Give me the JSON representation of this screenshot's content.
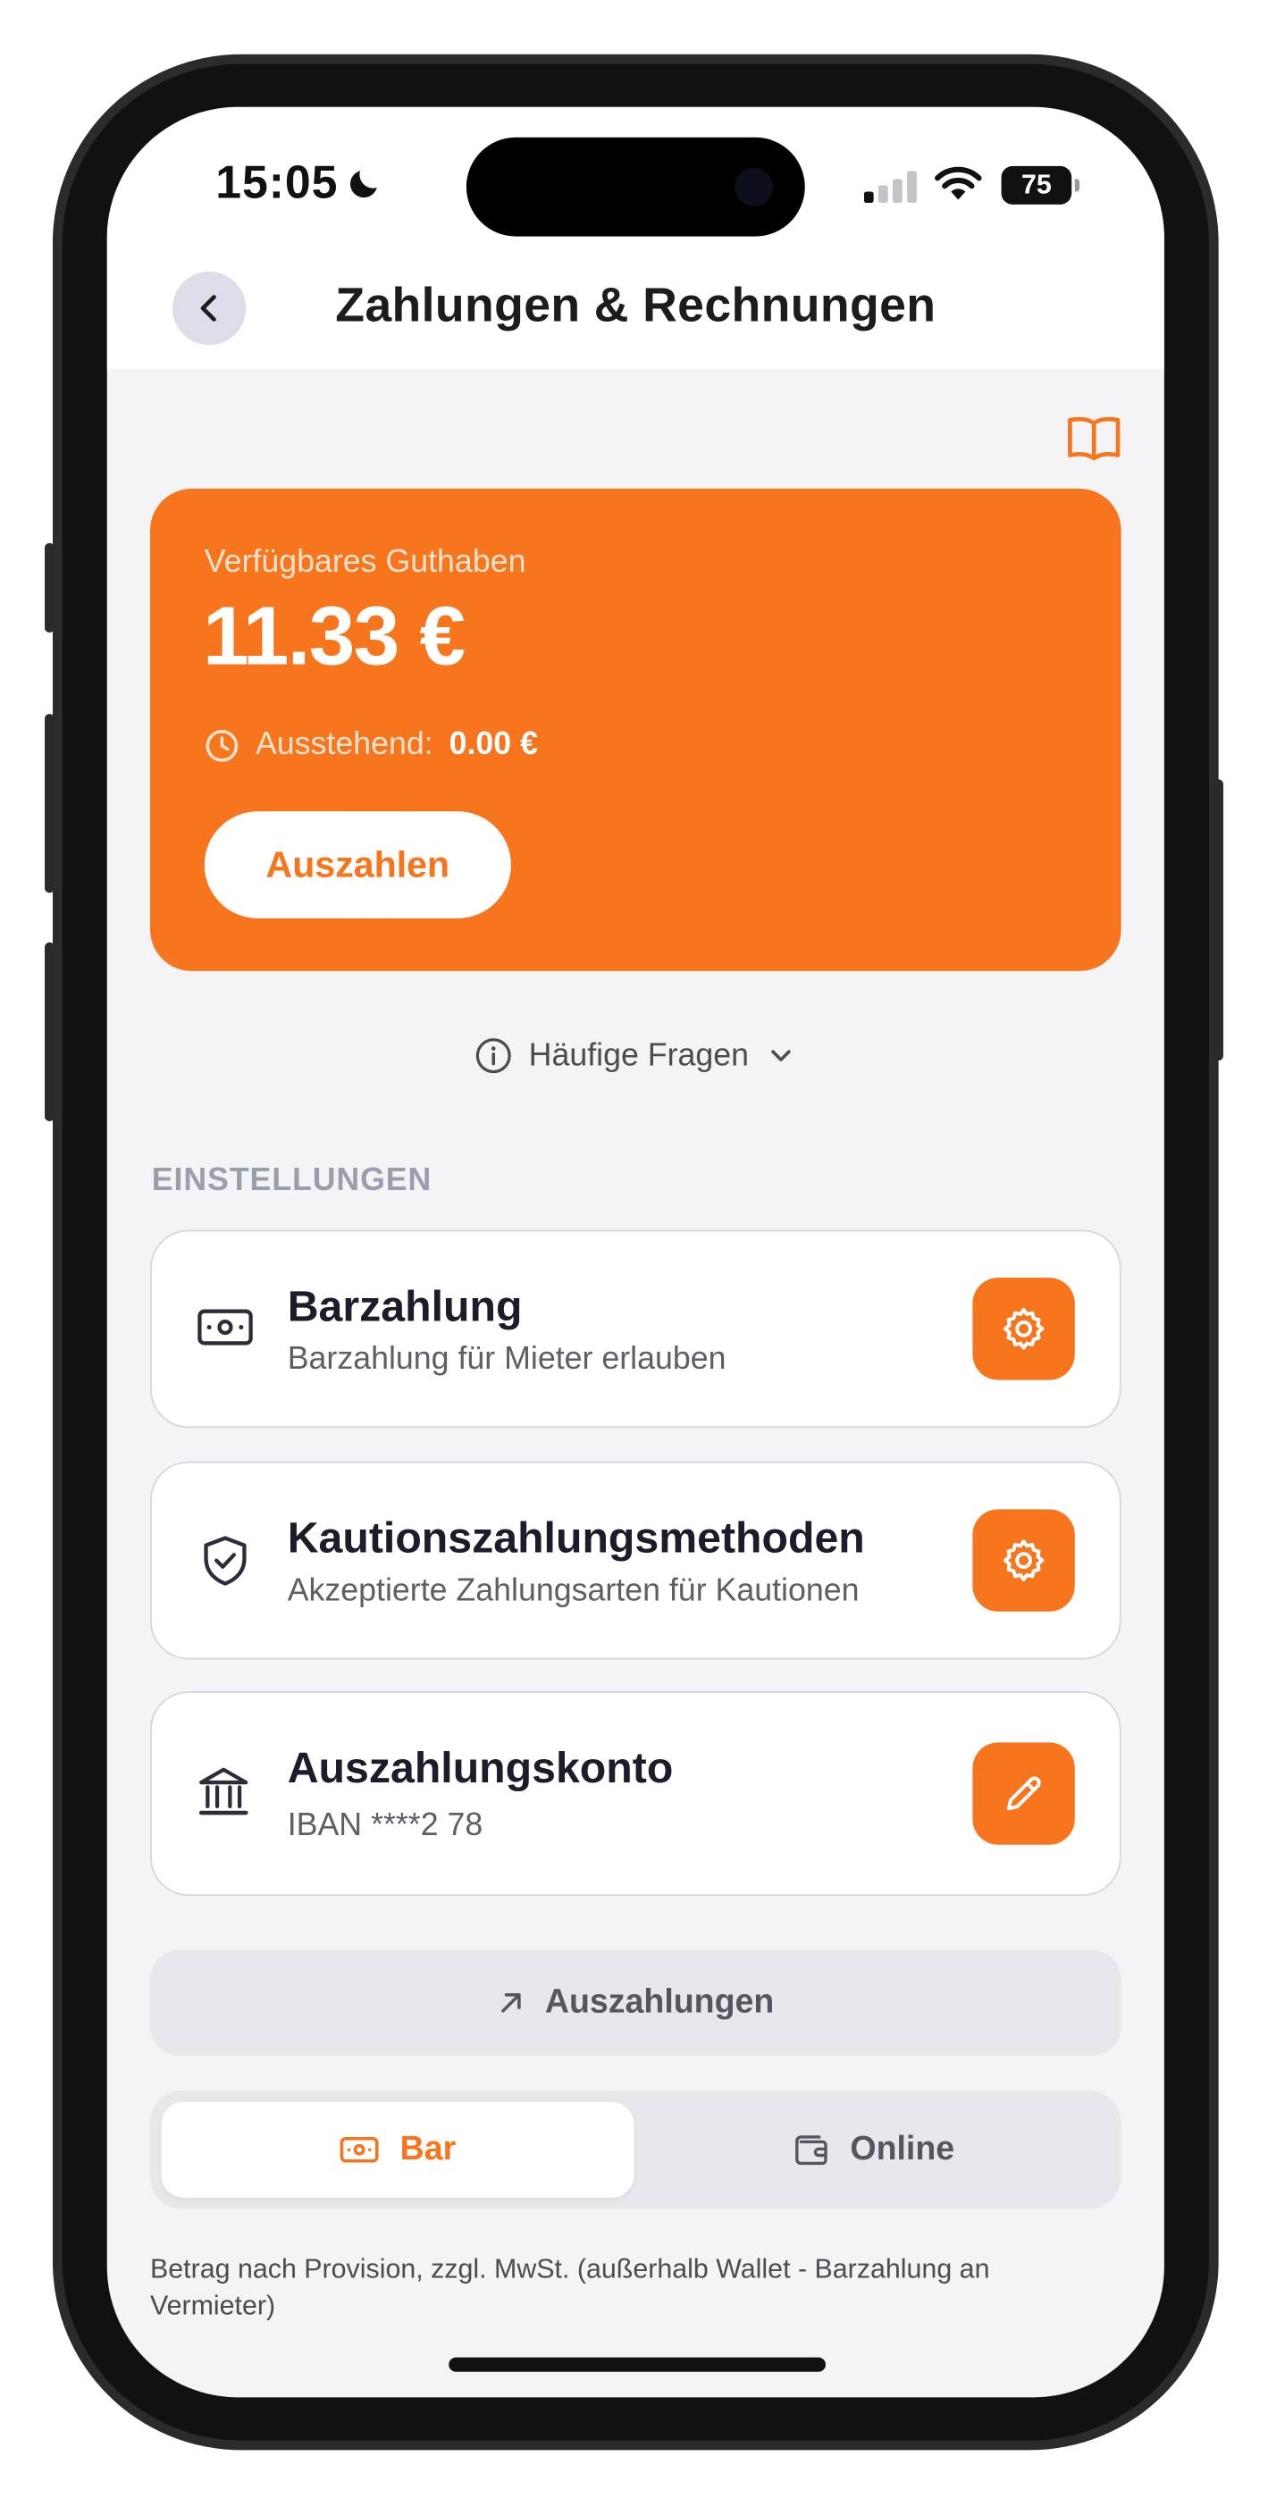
{
  "status_bar": {
    "time": "15:05",
    "battery": "75"
  },
  "header": {
    "title": "Zahlungen & Rechnungen"
  },
  "balance": {
    "label": "Verfügbares Guthaben",
    "amount": "11.33 €",
    "pending_label": "Ausstehend:",
    "pending_value": "0.00 €",
    "payout_button": "Auszahlen"
  },
  "faq": {
    "label": "Häufige Fragen"
  },
  "settings": {
    "section_label": "EINSTELLUNGEN",
    "items": [
      {
        "title": "Barzahlung",
        "subtitle": "Barzahlung für Mieter erlauben",
        "icon": "cash-icon",
        "action_icon": "gear-icon"
      },
      {
        "title": "Kautionszahlungsmethoden",
        "subtitle": "Akzeptierte Zahlungsarten für Kautionen",
        "icon": "shield-check-icon",
        "action_icon": "gear-icon"
      },
      {
        "title": "Auszahlungskonto",
        "subtitle": "IBAN ****2 78",
        "icon": "bank-icon",
        "action_icon": "pencil-icon"
      }
    ]
  },
  "payouts_button": {
    "label": "Auszahlungen"
  },
  "segment": {
    "options": [
      {
        "label": "Bar",
        "icon": "cash-icon",
        "selected": true
      },
      {
        "label": "Online",
        "icon": "wallet-icon",
        "selected": false
      }
    ]
  },
  "footnote": "Betrag nach Provision, zzgl. MwSt. (außerhalb Wallet - Barzahlung an Vermieter)",
  "colors": {
    "accent": "#f7751c",
    "background": "#f4f4f6",
    "card_border": "#d5d5e0"
  }
}
